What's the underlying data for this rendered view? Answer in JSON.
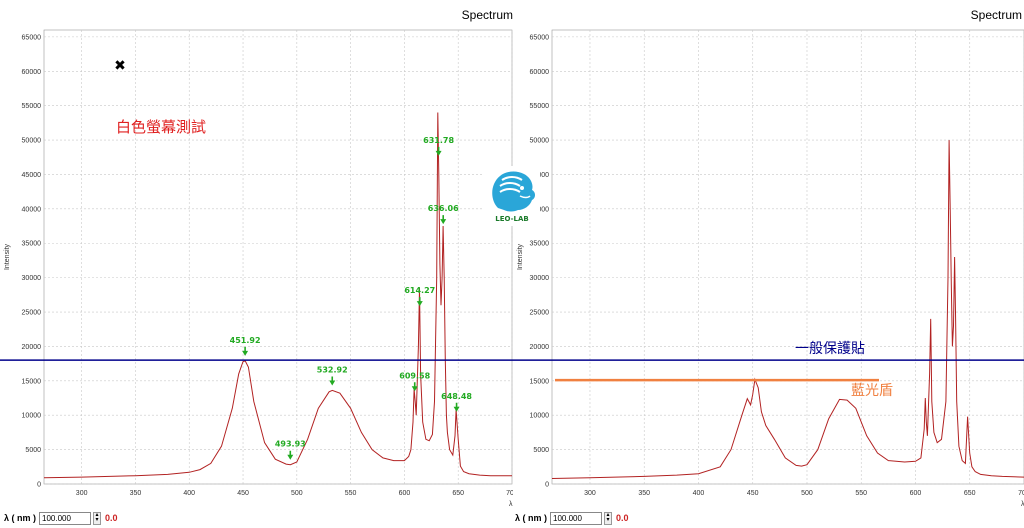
{
  "panels": {
    "left": {
      "title": "Spectrum",
      "annotation_text": "白色螢幕測試",
      "marker_symbol": "✖",
      "blue_line_value": 18000,
      "status": {
        "lambda_label": "λ ( nm )",
        "value": "100.000",
        "readout": "0.0"
      }
    },
    "right": {
      "title": "Spectrum",
      "blue_line_label": "一般保護貼",
      "orange_line_label": "藍光盾",
      "blue_line_value": 18000,
      "orange_line_value": 15100,
      "status": {
        "lambda_label": "λ ( nm )",
        "value": "100.000",
        "readout": "0.0"
      }
    }
  },
  "logo_text": "LEO-LAB",
  "colors": {
    "spectrum": "#b22222",
    "grid": "#c8c8c8",
    "blue_line": "#00008b",
    "orange_line": "#f08040",
    "peak_label": "#22aa22",
    "annotation_red": "#e02020"
  },
  "chart_data": [
    {
      "type": "line",
      "title": "Spectrum",
      "xlabel": "λ (",
      "ylabel": "Intensity",
      "xlim": [
        265,
        700
      ],
      "ylim": [
        0,
        66000
      ],
      "x_ticks": [
        300,
        350,
        400,
        450,
        500,
        550,
        600,
        650,
        700
      ],
      "y_ticks": [
        0,
        5000,
        10000,
        15000,
        20000,
        25000,
        30000,
        35000,
        40000,
        45000,
        50000,
        55000,
        60000,
        65000
      ],
      "grid": true,
      "series": [
        {
          "x": [
            265,
            300,
            350,
            380,
            400,
            410,
            420,
            430,
            440,
            446,
            450,
            452,
            455,
            460,
            470,
            480,
            490,
            494,
            500,
            510,
            520,
            530,
            533,
            540,
            550,
            560,
            570,
            580,
            590,
            600,
            604,
            606,
            608,
            609,
            610,
            611,
            613,
            614,
            615,
            617,
            620,
            623,
            626,
            628,
            630,
            631,
            632,
            633,
            634,
            635,
            636,
            637,
            638,
            639,
            640,
            642,
            645,
            647,
            648,
            650,
            652,
            655,
            660,
            670,
            680,
            700
          ],
          "y": [
            900,
            1000,
            1200,
            1400,
            1700,
            2100,
            3000,
            5500,
            11000,
            16000,
            17800,
            17900,
            17000,
            12000,
            6000,
            3600,
            2900,
            2800,
            3200,
            6500,
            11000,
            13400,
            13600,
            13200,
            11000,
            7500,
            5000,
            3800,
            3400,
            3400,
            4000,
            5000,
            9000,
            13800,
            12000,
            10000,
            20000,
            28500,
            16000,
            9000,
            6500,
            6300,
            7200,
            12000,
            30000,
            54000,
            45000,
            32000,
            26000,
            30000,
            37500,
            30000,
            18000,
            10000,
            7500,
            5000,
            4200,
            7000,
            10800,
            6500,
            2600,
            1800,
            1500,
            1300,
            1200,
            1200
          ]
        }
      ],
      "annotations": [
        {
          "label": "451.92",
          "x": 451.92
        },
        {
          "label": "493.93",
          "x": 493.93
        },
        {
          "label": "532.92",
          "x": 532.92
        },
        {
          "label": "609.58",
          "x": 609.58
        },
        {
          "label": "614.27",
          "x": 614.27
        },
        {
          "label": "631.78",
          "x": 631.78
        },
        {
          "label": "636.06",
          "x": 636.06
        },
        {
          "label": "648.48",
          "x": 648.48
        }
      ]
    },
    {
      "type": "line",
      "title": "Spectrum",
      "xlabel": "λ (",
      "ylabel": "Intensity",
      "xlim": [
        265,
        700
      ],
      "ylim": [
        0,
        66000
      ],
      "x_ticks": [
        300,
        350,
        400,
        450,
        500,
        550,
        600,
        650,
        700
      ],
      "y_ticks": [
        0,
        5000,
        10000,
        15000,
        20000,
        25000,
        30000,
        35000,
        40000,
        45000,
        50000,
        55000,
        60000,
        65000
      ],
      "grid": true,
      "series": [
        {
          "x": [
            265,
            300,
            350,
            380,
            400,
            420,
            430,
            440,
            445,
            448,
            450,
            452,
            455,
            458,
            462,
            470,
            480,
            490,
            495,
            500,
            510,
            520,
            530,
            537,
            545,
            555,
            565,
            575,
            590,
            600,
            605,
            608,
            609,
            610,
            611,
            613,
            614,
            615,
            617,
            620,
            624,
            628,
            630,
            631,
            632,
            633,
            634,
            635,
            636,
            637,
            638,
            640,
            643,
            646,
            648,
            650,
            652,
            655,
            660,
            670,
            680,
            700
          ],
          "y": [
            800,
            900,
            1100,
            1300,
            1500,
            2500,
            5000,
            10000,
            12400,
            11500,
            13000,
            15200,
            14000,
            10500,
            8500,
            6500,
            3800,
            2700,
            2600,
            2800,
            5000,
            9500,
            12300,
            12200,
            11000,
            7000,
            4500,
            3400,
            3200,
            3300,
            3800,
            8000,
            12500,
            9000,
            7000,
            16000,
            24000,
            12000,
            7500,
            6000,
            6500,
            12000,
            30000,
            50000,
            40000,
            29000,
            20000,
            23000,
            33000,
            24000,
            12000,
            5500,
            3400,
            3000,
            9800,
            4500,
            2500,
            1800,
            1400,
            1200,
            1100,
            1000
          ]
        }
      ]
    }
  ]
}
